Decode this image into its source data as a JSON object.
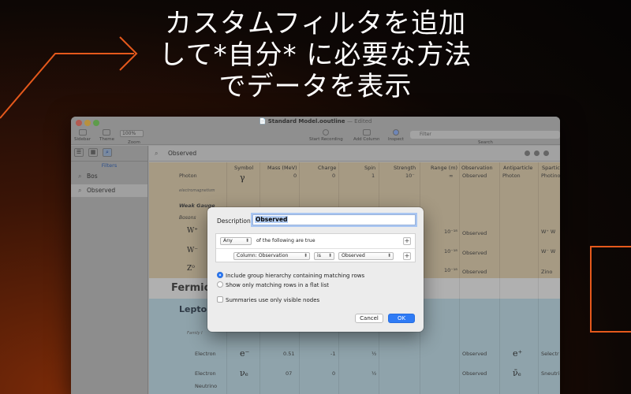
{
  "promo": {
    "line1": "カスタムフィルタを追加",
    "line2": "して*自分* に必要な方法",
    "line3": "でデータを表示"
  },
  "window": {
    "title": "Standard Model.ooutline",
    "edited": "— Edited",
    "toolbar": {
      "sidebar": "Sidebar",
      "theme": "Theme",
      "zoom_value": "100%",
      "zoom": "Zoom",
      "start_recording": "Start Recording",
      "add_column": "Add Column",
      "inspect": "Inspect",
      "search_placeholder": "Filter",
      "search": "Search"
    }
  },
  "sidebar": {
    "filters_label": "Filters",
    "items": [
      {
        "label": "Bos"
      },
      {
        "label": "Observed"
      }
    ]
  },
  "filterbar": {
    "title": "Observed"
  },
  "table": {
    "columns": [
      "Symbol",
      "Mass (MeV)",
      "Charge",
      "Spin",
      "Strength",
      "Range (m)",
      "Observation",
      "Antiparticle",
      "Spartic"
    ],
    "rows": {
      "photon": {
        "name": "Photon",
        "symbol": "γ",
        "mass": "0",
        "charge": "0",
        "spin": "1",
        "strength": "10⁻",
        "range": "∞",
        "obs": "Observed",
        "anti": "Photon",
        "spart": "Photino"
      },
      "em_note": "electromagnetism",
      "weak": "Weak Gauge",
      "bosons": "Bosons",
      "wplus": {
        "symbol": "W⁺",
        "range": "10⁻¹⁸",
        "obs": "Observed",
        "anti": "W⁺ W"
      },
      "wminus": {
        "symbol": "W⁻",
        "range": "10⁻¹⁸",
        "obs": "Observed",
        "anti": "W⁻ W"
      },
      "z0": {
        "symbol": "Z⁰",
        "range": "10⁻¹⁸",
        "obs": "Observed",
        "anti": "Zino"
      },
      "fermions": "Fermion",
      "leptons": "Lepton",
      "family": "Family I",
      "electron": {
        "name": "Electron",
        "symbol": "e⁻",
        "mass": "0.51",
        "charge": "-1",
        "spin": "½",
        "obs": "Observed",
        "anti": "e⁺",
        "spart": "Selectr"
      },
      "neutrino": {
        "name1": "Electron",
        "name2": "Neutrino",
        "symbol": "νₑ",
        "mass": "07",
        "charge": "0",
        "spin": "½",
        "obs": "Observed",
        "anti": "ν̄ₑ",
        "spart": "Sneutri"
      }
    }
  },
  "dialog": {
    "description_label": "Description:",
    "description_value": "Observed",
    "match_popup": "Any",
    "match_text": "of the following are true",
    "field_popup": "Column: Observation",
    "op_popup": "is",
    "value_popup": "Observed",
    "radio1": "Include group hierarchy containing matching rows",
    "radio2": "Show only matching rows in a flat list",
    "checkbox": "Summaries use only visible nodes",
    "cancel": "Cancel",
    "ok": "OK",
    "plus": "+"
  },
  "colors": {
    "accent": "#2f7bf5",
    "deco_orange": "#e5591c"
  }
}
